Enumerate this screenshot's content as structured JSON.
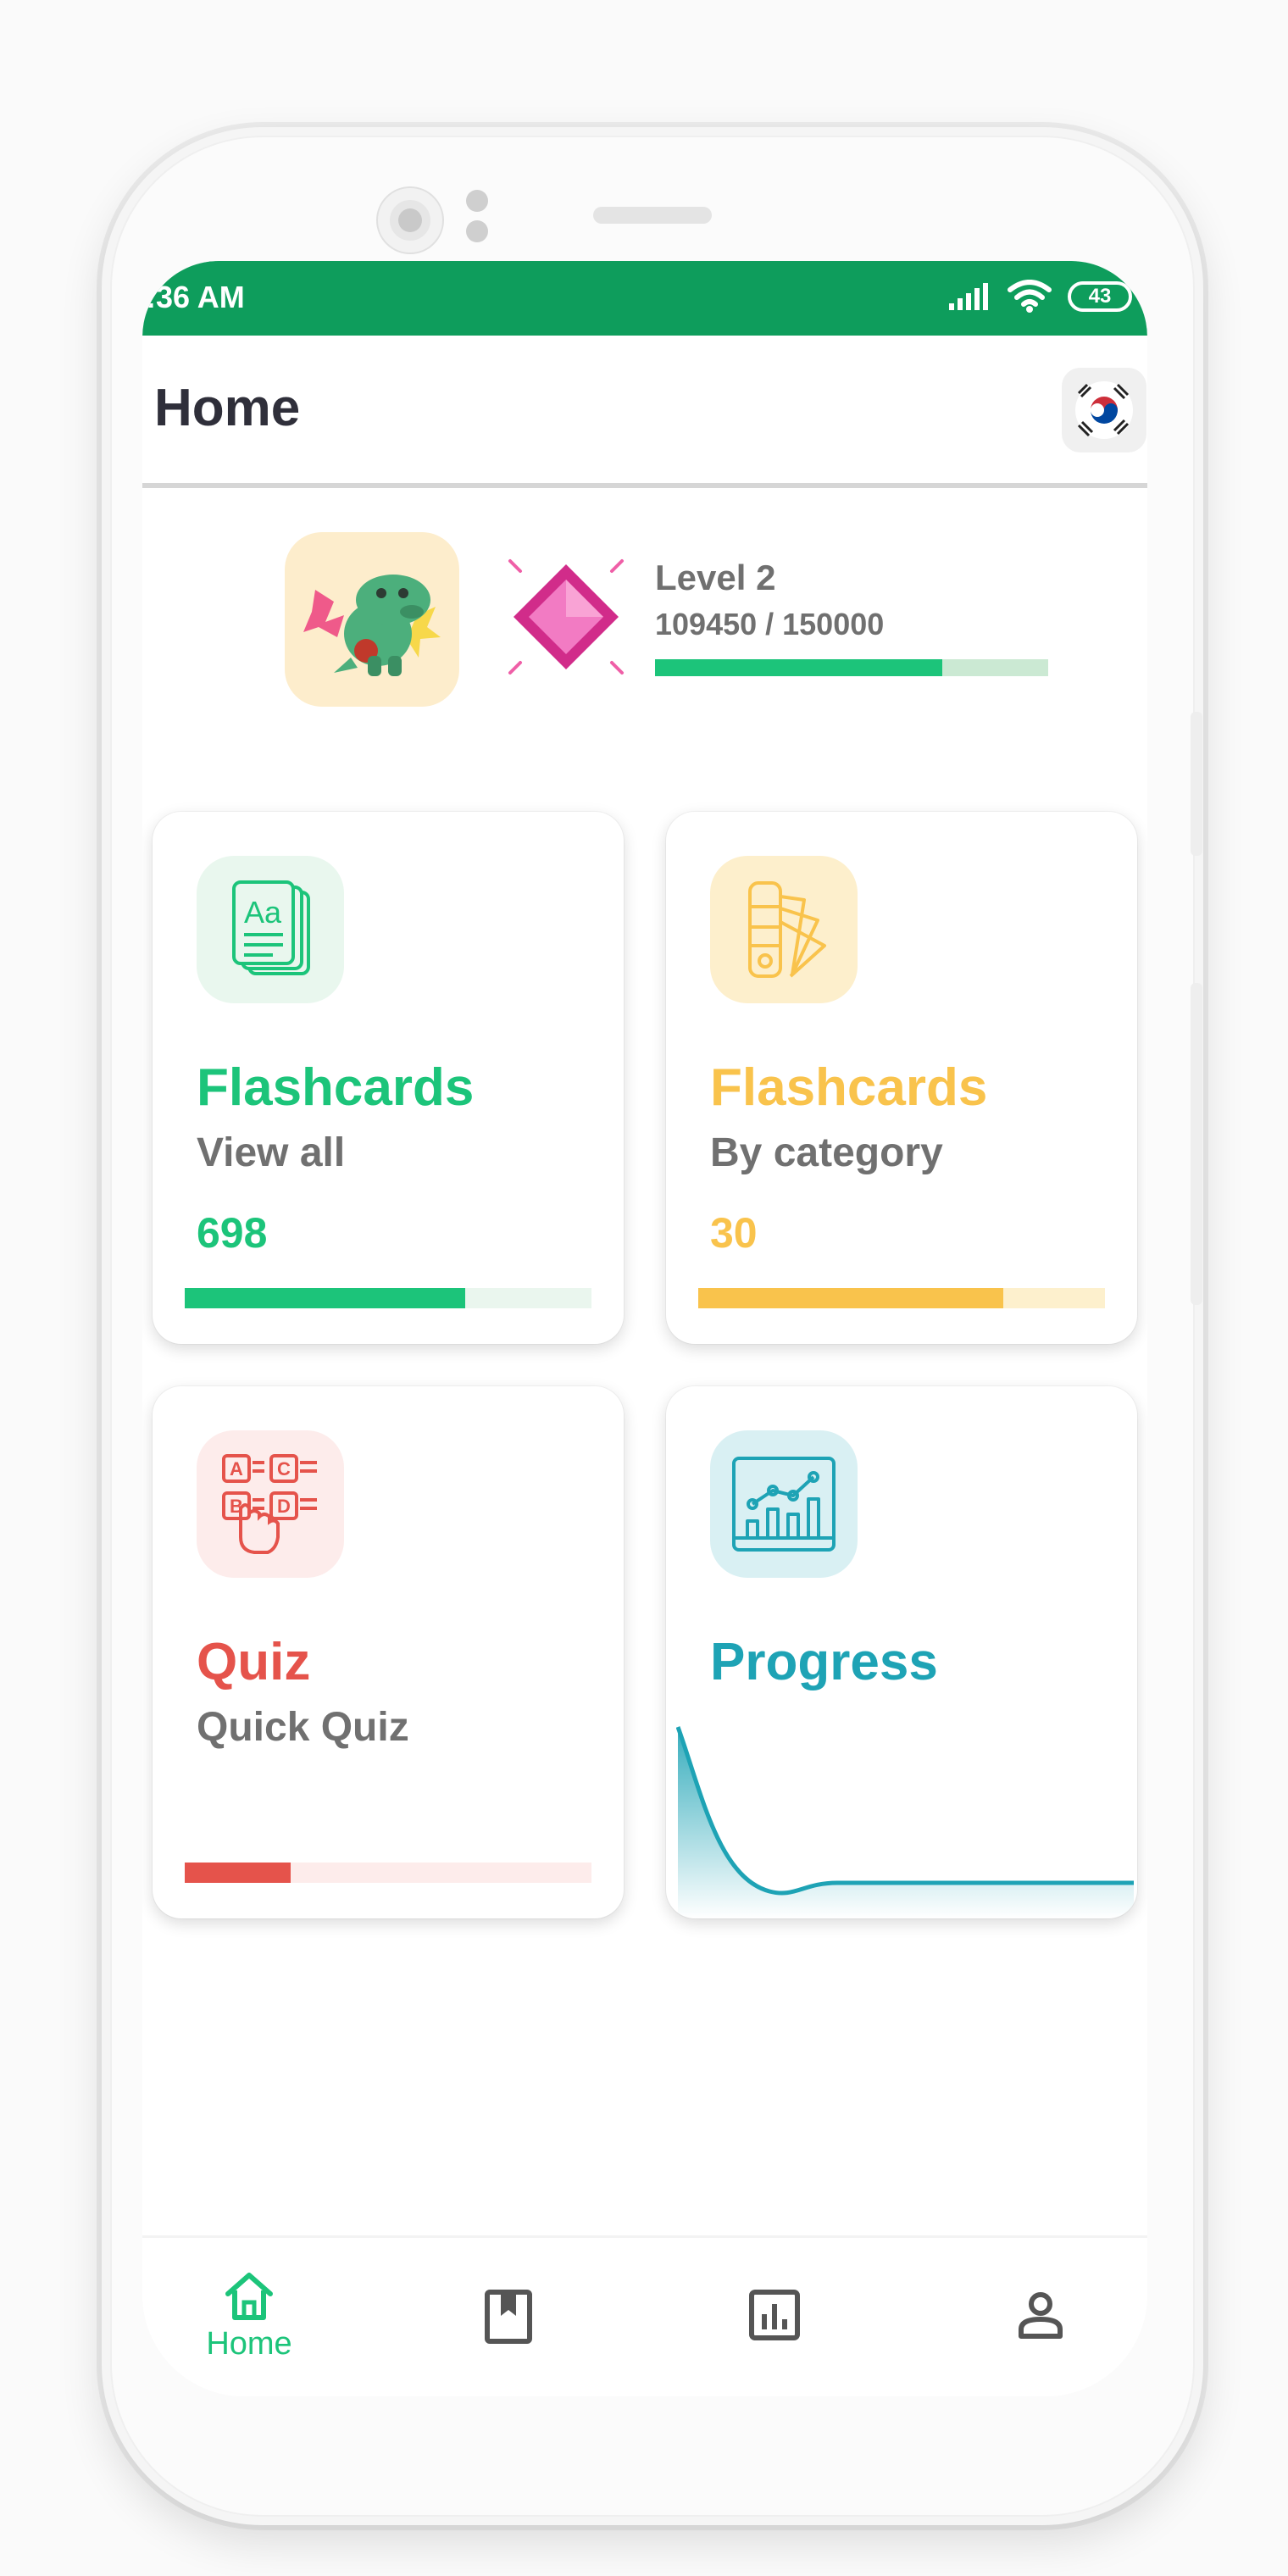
{
  "status_bar": {
    "time": ":36 AM",
    "battery": "43",
    "color": "#0e9d5c"
  },
  "header": {
    "title": "Home",
    "language_flag_icon": "korea-flag-icon"
  },
  "profile": {
    "avatar_icon": "dinosaur-avatar-icon",
    "badge_icon": "pink-gem-icon",
    "level_label": "Level 2",
    "xp_text": "109450 / 150000",
    "xp_current": 109450,
    "xp_total": 150000
  },
  "cards": [
    {
      "title": "Flashcards",
      "subtitle": "View all",
      "count": "698",
      "icon": "flashcards-book-icon",
      "accent": "#1cc47a",
      "track": "#eaf6ee",
      "icon_bg": "#e9f7ee",
      "progress": 0.69
    },
    {
      "title": "Flashcards",
      "subtitle": "By category",
      "count": "30",
      "icon": "color-swatch-fan-icon",
      "accent": "#f9c34c",
      "track": "#fdf0cd",
      "icon_bg": "#fdefcc",
      "progress": 0.75
    },
    {
      "title": "Quiz",
      "subtitle": "Quick Quiz",
      "count": "",
      "icon": "quiz-choice-hand-icon",
      "accent": "#e5534b",
      "track": "#fdeceb",
      "icon_bg": "#fdeceb",
      "progress": 0.26
    },
    {
      "title": "Progress",
      "subtitle": "",
      "count": "",
      "icon": "progress-chart-icon",
      "accent": "#1ea3b5",
      "track": "",
      "icon_bg": "#d9f0f3",
      "progress": null
    }
  ],
  "bottom_nav": {
    "items": [
      {
        "label": "Home",
        "icon": "home-icon",
        "active": true
      },
      {
        "label": "",
        "icon": "bookmark-book-icon",
        "active": false
      },
      {
        "label": "",
        "icon": "bar-chart-icon",
        "active": false
      },
      {
        "label": "",
        "icon": "profile-person-icon",
        "active": false
      }
    ],
    "active_color": "#1cc47a",
    "inactive_color": "#555555"
  }
}
